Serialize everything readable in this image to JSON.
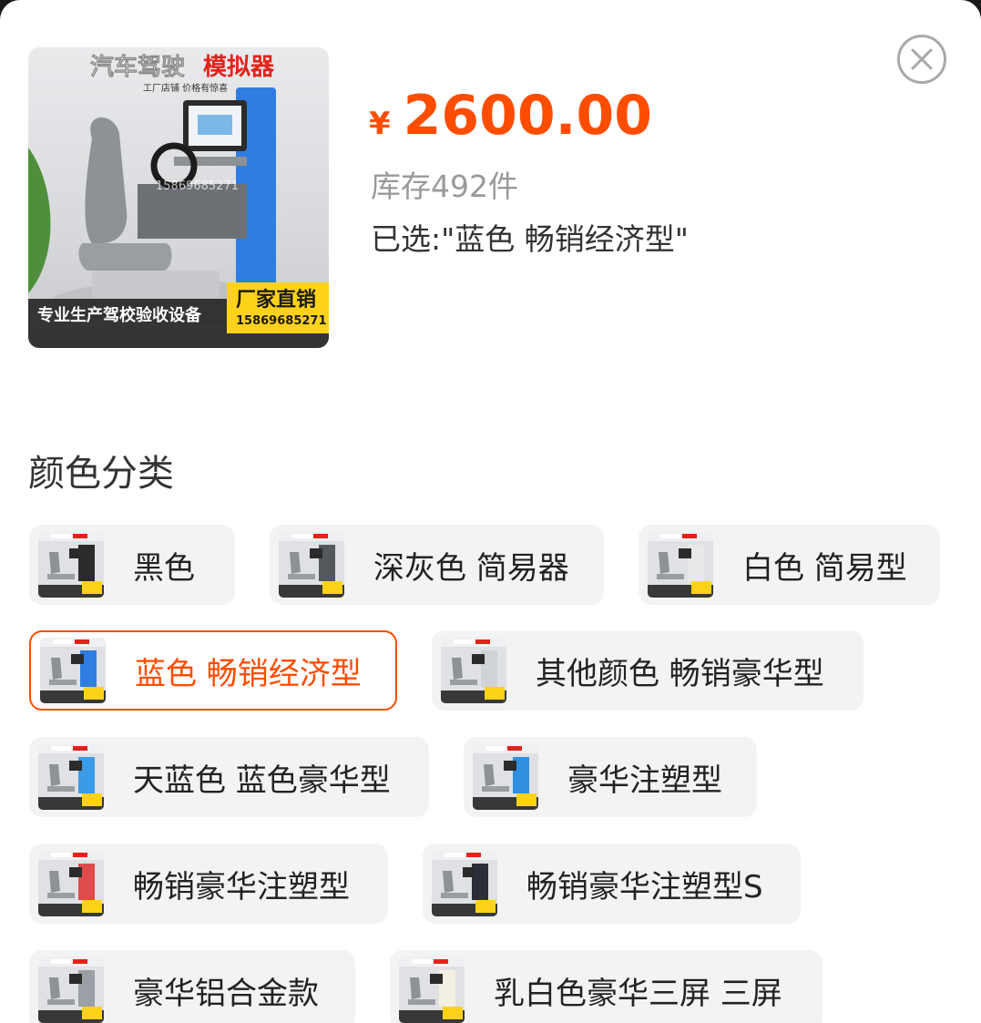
{
  "product": {
    "thumb_title_white": "汽车驾驶",
    "thumb_title_red": "模拟器",
    "thumb_subtitle": "工厂店铺 价格有惊喜",
    "thumb_footer_left": "专业生产驾校验收设备",
    "thumb_badge_title": "厂家直销",
    "thumb_badge_phone": "15869685271",
    "thumb_watermark": "15869685271",
    "price_currency": "¥",
    "price_amount": "2600.00",
    "stock": "库存492件",
    "selected": "已选:\"蓝色 畅销经济型\""
  },
  "section": {
    "title": "颜色分类"
  },
  "options": [
    {
      "label": "黑色",
      "selected": false,
      "accent": "#2b2b2b"
    },
    {
      "label": "深灰色 简易器",
      "selected": false,
      "accent": "#55585c"
    },
    {
      "label": "白色 简易型",
      "selected": false,
      "accent": "#e8e8e8"
    },
    {
      "label": "蓝色 畅销经济型",
      "selected": true,
      "accent": "#2f7de1"
    },
    {
      "label": "其他颜色 畅销豪华型",
      "selected": false,
      "accent": "#d0d3d6"
    },
    {
      "label": "天蓝色 蓝色豪华型",
      "selected": false,
      "accent": "#3a9be8"
    },
    {
      "label": "豪华注塑型",
      "selected": false,
      "accent": "#2f8fe0"
    },
    {
      "label": "畅销豪华注塑型",
      "selected": false,
      "accent": "#e04a4a"
    },
    {
      "label": "畅销豪华注塑型S",
      "selected": false,
      "accent": "#2a2f38"
    },
    {
      "label": "豪华铝合金款",
      "selected": false,
      "accent": "#9aa0a6"
    },
    {
      "label": "乳白色豪华三屏 三屏",
      "selected": false,
      "accent": "#f3efe3"
    }
  ],
  "colors": {
    "accent": "#ff4d00",
    "chip_bg": "#f3f3f3",
    "badge_yellow": "#ffd21a"
  },
  "icons": {
    "close": "close-icon"
  }
}
